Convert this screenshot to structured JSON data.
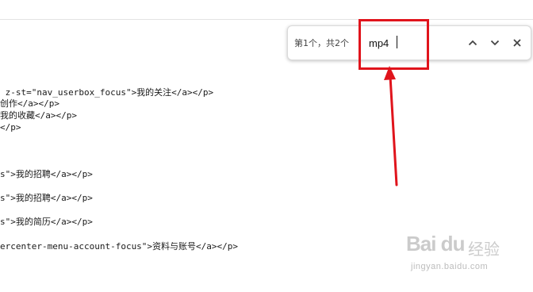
{
  "source_lines": [
    " z-st=\"nav_userbox_focus\">我的关注</a></p>",
    "创作</a></p>",
    "我的收藏</a></p>",
    "</p>",
    "s\">我的招聘</a></p>",
    "s\">我的招聘</a></p>",
    "s\">我的简历</a></p>",
    "ercenter-menu-account-focus\">资料与账号</a></p>"
  ],
  "find_bar": {
    "count_text": "第1个，共2个",
    "query": "mp4",
    "icons": [
      "chevron-up-icon",
      "chevron-down-icon",
      "close-icon"
    ]
  },
  "annotation": {
    "color": "#e0141c"
  },
  "watermark": {
    "logo": "Bai du",
    "cn": "经验",
    "url": "jingyan.baidu.com"
  }
}
